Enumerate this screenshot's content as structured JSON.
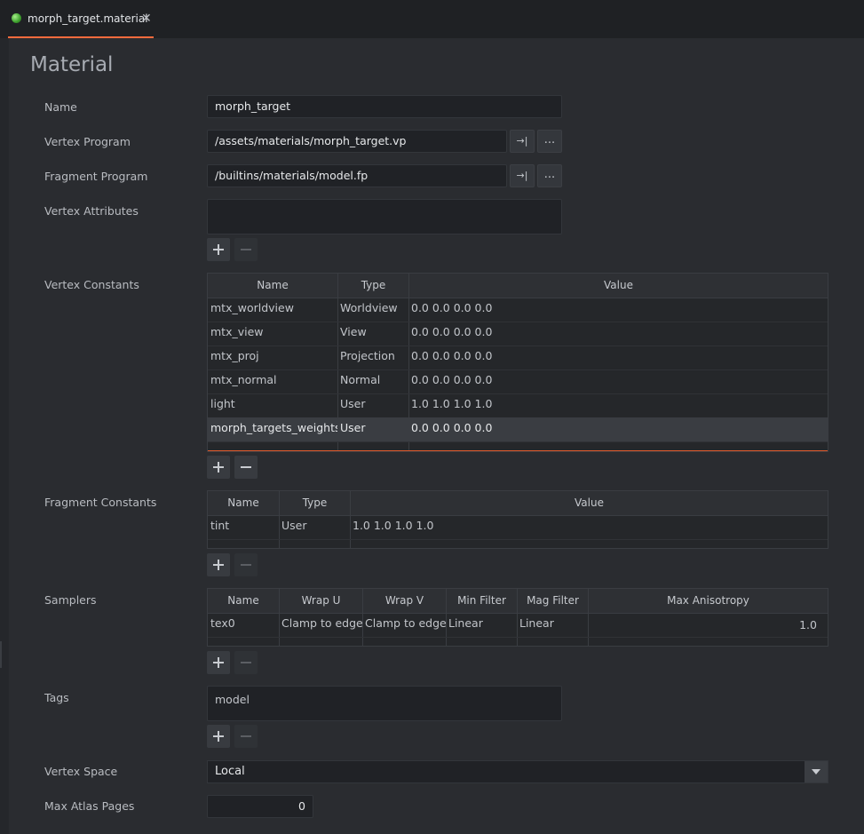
{
  "tab": {
    "title": "morph_target.material",
    "close": "✕"
  },
  "page": {
    "heading": "Material"
  },
  "labels": {
    "name": "Name",
    "vertex_program": "Vertex Program",
    "fragment_program": "Fragment Program",
    "vertex_attributes": "Vertex Attributes",
    "vertex_constants": "Vertex Constants",
    "fragment_constants": "Fragment Constants",
    "samplers": "Samplers",
    "tags": "Tags",
    "vertex_space": "Vertex Space",
    "max_atlas_pages": "Max Atlas Pages"
  },
  "fields": {
    "name": "morph_target",
    "vertex_program": "/assets/materials/morph_target.vp",
    "fragment_program": "/builtins/materials/model.fp",
    "goto_icon": "→|",
    "browse_label": "...",
    "vertex_space": "Local",
    "max_atlas_pages": "0"
  },
  "vertex_constants": {
    "columns": [
      "Name",
      "Type",
      "Value"
    ],
    "rows": [
      {
        "name": "mtx_worldview",
        "type": "Worldview",
        "value": "0.0  0.0  0.0  0.0"
      },
      {
        "name": "mtx_view",
        "type": "View",
        "value": "0.0  0.0  0.0  0.0"
      },
      {
        "name": "mtx_proj",
        "type": "Projection",
        "value": "0.0  0.0  0.0  0.0"
      },
      {
        "name": "mtx_normal",
        "type": "Normal",
        "value": "0.0  0.0  0.0  0.0"
      },
      {
        "name": "light",
        "type": "User",
        "value": "1.0  1.0  1.0  1.0"
      },
      {
        "name": "morph_targets_weights",
        "type": "User",
        "value": "0.0  0.0  0.0  0.0"
      }
    ]
  },
  "fragment_constants": {
    "columns": [
      "Name",
      "Type",
      "Value"
    ],
    "rows": [
      {
        "name": "tint",
        "type": "User",
        "value": "1.0  1.0  1.0  1.0"
      }
    ]
  },
  "samplers": {
    "columns": [
      "Name",
      "Wrap U",
      "Wrap V",
      "Min Filter",
      "Mag Filter",
      "Max Anisotropy"
    ],
    "rows": [
      {
        "name": "tex0",
        "wrap_u": "Clamp to edge",
        "wrap_v": "Clamp to edge",
        "min_filter": "Linear",
        "mag_filter": "Linear",
        "max_anisotropy": "1.0"
      }
    ]
  },
  "tags": [
    "model"
  ],
  "colors": {
    "accent": "#ff6b3d",
    "background": "#2a2c30",
    "tab_bar": "#1f2124"
  }
}
